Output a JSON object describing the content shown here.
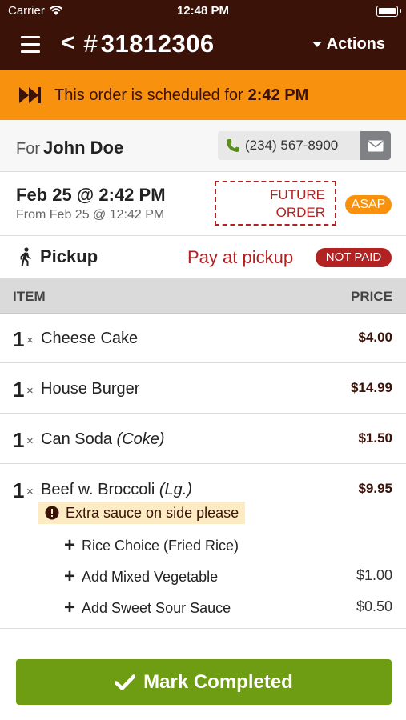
{
  "status_bar": {
    "carrier": "Carrier",
    "time": "12:48 PM"
  },
  "nav": {
    "title_hash": "#",
    "order_number": "31812306",
    "actions_label": "Actions"
  },
  "banner": {
    "text": "This order is scheduled for",
    "time": "2:42 PM"
  },
  "customer": {
    "for_label": "For",
    "name": "John Doe",
    "phone": "(234) 567-8900"
  },
  "schedule": {
    "date": "Feb 25 @ 2:42 PM",
    "from": "From Feb 25 @ 12:42 PM",
    "future_line1": "FUTURE",
    "future_line2": "ORDER",
    "asap": "ASAP"
  },
  "pickup": {
    "label": "Pickup",
    "payment": "Pay at pickup",
    "payment_status": "NOT PAID"
  },
  "table": {
    "col_item": "ITEM",
    "col_price": "PRICE"
  },
  "items": [
    {
      "qty": "1",
      "x": "×",
      "name": "Cheese Cake",
      "variant": "",
      "price": "$4.00"
    },
    {
      "qty": "1",
      "x": "×",
      "name": "House Burger",
      "variant": "",
      "price": "$14.99"
    },
    {
      "qty": "1",
      "x": "×",
      "name": "Can Soda",
      "variant": "(Coke)",
      "price": "$1.50"
    },
    {
      "qty": "1",
      "x": "×",
      "name": "Beef w. Broccoli",
      "variant": "(Lg.)",
      "price": "$9.95",
      "note": "Extra sauce on side please",
      "modifiers": [
        {
          "label": "Rice Choice (Fried Rice)",
          "price": ""
        },
        {
          "label": "Add Mixed Vegetable",
          "price": "$1.00"
        },
        {
          "label": "Add Sweet Sour Sauce",
          "price": "$0.50"
        }
      ]
    }
  ],
  "footer": {
    "button_label": "Mark Completed"
  },
  "colors": {
    "header_bg": "#3a1208",
    "banner_bg": "#f7910e",
    "accent_red": "#b22222",
    "button_green": "#6e9c12"
  }
}
